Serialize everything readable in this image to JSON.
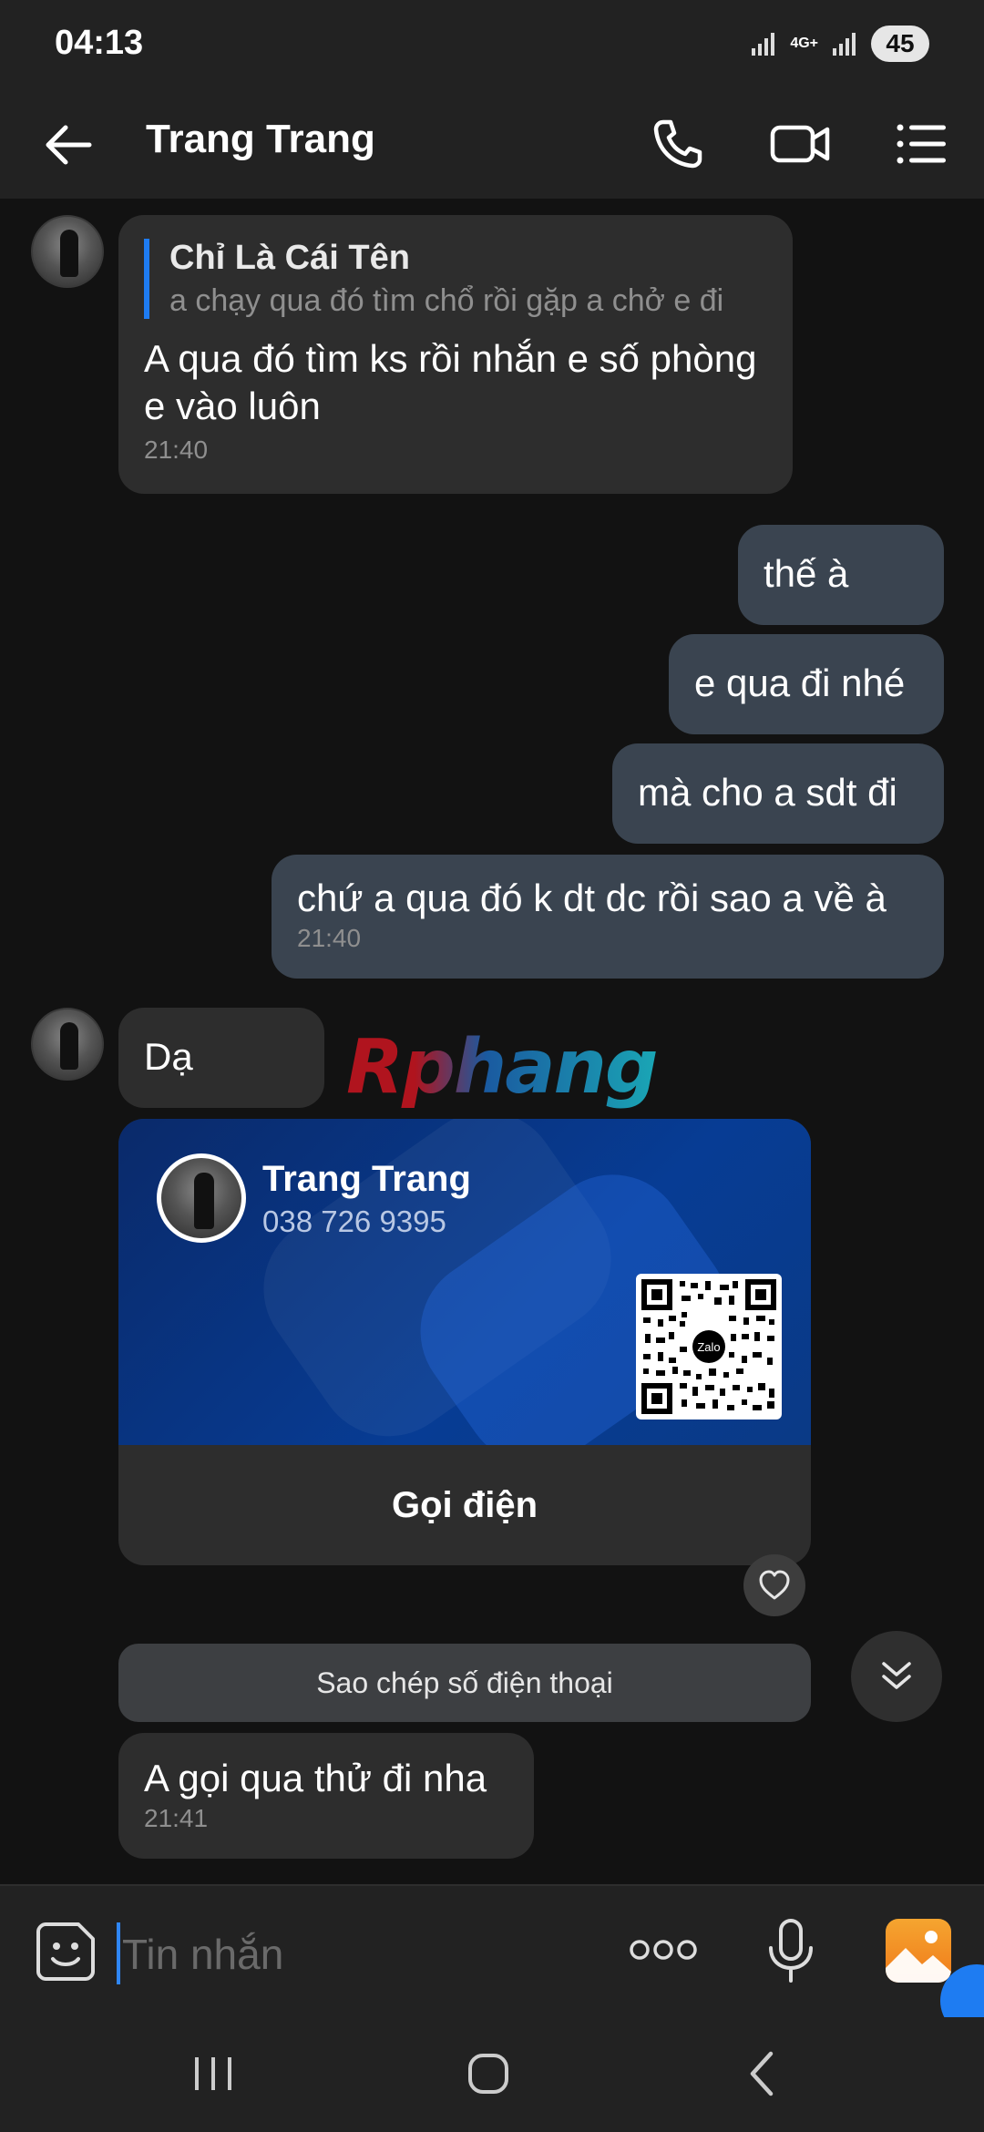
{
  "status_bar": {
    "time": "04:13",
    "network": "4G+",
    "battery": "45"
  },
  "header": {
    "title": "Trang Trang"
  },
  "messages": {
    "m1": {
      "quote_name": "Chỉ Là Cái Tên",
      "quote_text": "a chạy qua đó tìm chổ rồi gặp a chở e đi",
      "text": "A qua đó tìm ks rồi nhắn e số phòng e vào luôn",
      "time": "21:40"
    },
    "m2": {
      "text": "thế à"
    },
    "m3": {
      "text": "e qua đi nhé"
    },
    "m4": {
      "text": "mà cho a sdt đi"
    },
    "m5": {
      "text": "chứ a qua đó k dt dc rồi sao a về à",
      "time": "21:40"
    },
    "m6": {
      "text": "Dạ"
    },
    "m7": {
      "text": "A gọi qua thử đi nha",
      "time": "21:41"
    }
  },
  "watermark": "Rphang",
  "contact_card": {
    "name": "Trang Trang",
    "phone": "038 726 9395",
    "qr_logo": "Zalo",
    "call_label": "Gọi điện"
  },
  "copy_phone_label": "Sao chép số điện thoại",
  "input": {
    "placeholder": "Tin nhắn",
    "value": ""
  },
  "icons": {
    "back": "arrow-left-icon",
    "call": "phone-icon",
    "video": "video-camera-icon",
    "menu": "list-menu-icon",
    "sticker": "sticker-smile-icon",
    "more": "more-dots-icon",
    "mic": "microphone-icon",
    "gallery": "image-gallery-icon",
    "react": "heart-icon",
    "scroll_down": "double-chevron-down-icon"
  },
  "colors": {
    "background": "#121212",
    "bar": "#222222",
    "incoming_bubble": "#2d2d2d",
    "outgoing_bubble": "#3a4450",
    "accent": "#1e7cf2",
    "card_blue": "#073c94"
  }
}
